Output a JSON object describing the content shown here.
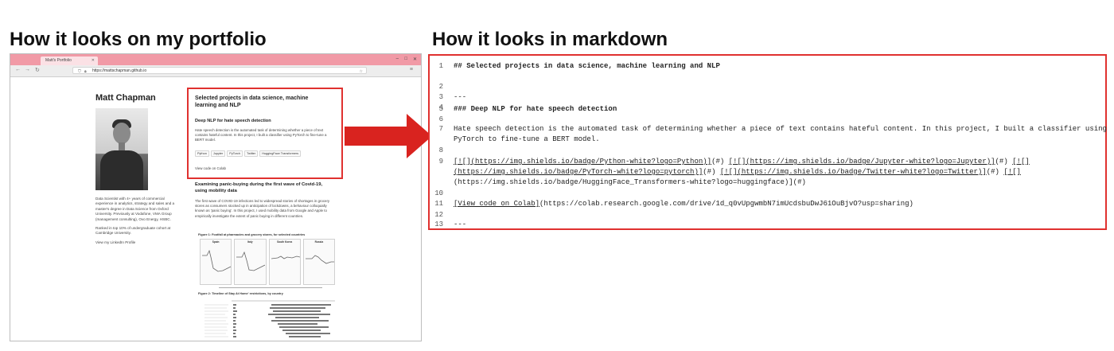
{
  "headings": {
    "left": "How it looks on my portfolio",
    "right": "How it looks in markdown"
  },
  "browser": {
    "tab_title": "Matt's Portfolio",
    "url": "https://mattschapman.github.io"
  },
  "portfolio": {
    "name": "Matt Chapman",
    "bio": [
      "Data Scientist with 4+ years of commercial experience in analytics, strategy and sales and a master's degree in Data Science from Oxford University. Previously at Vodafone, VMA Group (management consulting), Ovo Energy, HSBC.",
      "Ranked in top 10% of undergraduate cohort at Cambridge University.",
      "View my LinkedIn Profile"
    ],
    "section_title": "Selected projects in data science, machine learning and NLP",
    "project1": {
      "title": "Deep NLP for hate speech detection",
      "description": "Hate speech detection is the automated task of determining whether a piece of text contains hateful content. In this project, I built a classifier using PyTorch to fine-tune a BERT model.",
      "badges": [
        "Python",
        "Jupyter",
        "PyTorch",
        "Twitter",
        "HuggingFace Transformers"
      ],
      "colab_link": "View code on Colab"
    },
    "project2": {
      "title": "Examining panic-buying during the first wave of Covid-19, using mobility data",
      "description": "The first wave of COVID-19 infections led to widespread stories of shortages in grocery stores as consumers stocked up in anticipation of lockdowns, a behaviour colloquially known as 'panic buying'. In this project, I used mobility data from Google and Apple to empirically investigate the extent of panic buying in different countries.",
      "figure1_caption": "Figure 1: Footfall at pharmacies and grocery stores, for selected countries",
      "figure1_panels": [
        "Spain",
        "Italy",
        "South Korea",
        "Russia"
      ],
      "figure2_caption": "Figure 2: Timeline of Stay At Home' restrictions, by country"
    }
  },
  "markdown": {
    "line_numbers": [
      "1",
      "2",
      "3",
      "4",
      "5",
      "6",
      "7",
      "8",
      "9",
      "10",
      "11",
      "12",
      "13"
    ],
    "lines": {
      "l1": "## Selected projects in data science, machine learning and NLP",
      "l3": "---",
      "l5": "### Deep NLP for hate speech detection",
      "l7a": "Hate speech detection is the automated task of determining whether a piece of text contains hateful content. In this project, I built a classifier using",
      "l7b": "PyTorch to fine-tune a BERT model.",
      "l9a_1": "[![](https://img.shields.io/badge/Python-white?logo=Python)]",
      "l9a_2": "(#) ",
      "l9a_3": "[![](https://img.shields.io/badge/Jupyter-white?logo=Jupyter)]",
      "l9a_4": "(#) ",
      "l9a_5": "[![]",
      "l9b_1": "(https://img.shields.io/badge/PyTorch-white?logo=pytorch)]",
      "l9b_2": "(#) ",
      "l9b_3": "[![](https://img.shields.io/badge/Twitter-white?logo=Twitter)]",
      "l9b_4": "(#) ",
      "l9b_5": "[![]",
      "l9c": "(https://img.shields.io/badge/HuggingFace_Transformers-white?logo=huggingface)](#)",
      "l11_link": "[View code on Colab]",
      "l11_url": "(https://colab.research.google.com/drive/1d_q0vUpgwmbN7imUcdsbuDwJ61OuBjvO?usp=sharing)",
      "l13": "---"
    }
  },
  "colors": {
    "highlight_red": "#e0312f",
    "tab_bar_pink": "#f19aa6",
    "arrow_red": "#d9231f"
  }
}
